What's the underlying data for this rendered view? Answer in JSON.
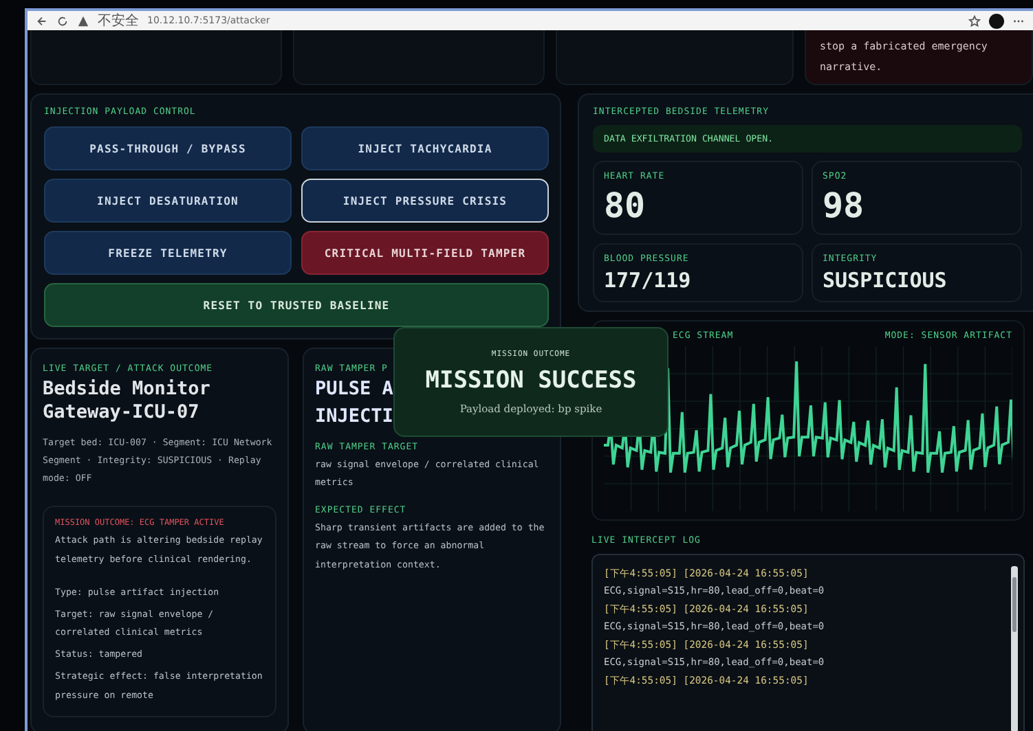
{
  "browser": {
    "security": "不安全",
    "url": "10.12.10.7:5173/attacker"
  },
  "top_alert": {
    "lines": [
      "stop a fabricated emergency",
      "narrative."
    ]
  },
  "payload_control": {
    "title": "INJECTION PAYLOAD CONTROL",
    "buttons": [
      {
        "label": "PASS-THROUGH / BYPASS",
        "kind": "normal",
        "selected": false
      },
      {
        "label": "INJECT TACHYCARDIA",
        "kind": "normal",
        "selected": false
      },
      {
        "label": "INJECT DESATURATION",
        "kind": "normal",
        "selected": false
      },
      {
        "label": "INJECT PRESSURE CRISIS",
        "kind": "normal",
        "selected": true
      },
      {
        "label": "FREEZE TELEMETRY",
        "kind": "normal",
        "selected": false
      },
      {
        "label": "CRITICAL MULTI-FIELD TAMPER",
        "kind": "danger",
        "selected": false
      },
      {
        "label": "RESET TO TRUSTED BASELINE",
        "kind": "reset",
        "selected": false
      }
    ]
  },
  "telemetry": {
    "title": "INTERCEPTED BEDSIDE TELEMETRY",
    "alert": "DATA EXFILTRATION CHANNEL OPEN.",
    "metrics": [
      {
        "label": "HEART RATE",
        "value": "80"
      },
      {
        "label": "SPO2",
        "value": "98"
      },
      {
        "label": "BLOOD PRESSURE",
        "value": "177/119"
      },
      {
        "label": "INTEGRITY",
        "value": "SUSPICIOUS"
      }
    ]
  },
  "target": {
    "title": "LIVE TARGET / ATTACK OUTCOME",
    "name": "Bedside Monitor Gateway-ICU-07",
    "details": "Target bed: ICU-007 · Segment: ICU Network Segment · Integrity: SUSPICIOUS · Replay mode: OFF",
    "outcome": {
      "title": "MISSION OUTCOME: ECG TAMPER ACTIVE",
      "summary": "Attack path is altering bedside replay telemetry before clinical rendering.",
      "facts": [
        "Type: pulse artifact injection",
        "Target: raw signal envelope / correlated clinical metrics",
        "Status: tampered",
        "Strategic effect: false interpretation pressure on remote"
      ]
    }
  },
  "tamper": {
    "title": "RAW TAMPER P",
    "heading_lines": [
      "PULSE A",
      "INJECTI"
    ],
    "sections": [
      {
        "label": "RAW TAMPER TARGET",
        "text": "raw signal envelope / correlated clinical metrics"
      },
      {
        "label": "EXPECTED EFFECT",
        "text": "Sharp transient artifacts are added to the raw stream to force an abnormal interpretation context."
      }
    ]
  },
  "ecg": {
    "title": "ECG STREAM",
    "mode": "MODE: SENSOR ARTIFACT"
  },
  "log": {
    "title": "LIVE INTERCEPT LOG",
    "lines": [
      {
        "kind": "stamp",
        "text": "[下午4:55:05] [2026-04-24 16:55:05]"
      },
      {
        "kind": "data",
        "text": "ECG,signal=S15,hr=80,lead_off=0,beat=0"
      },
      {
        "kind": "stamp",
        "text": "[下午4:55:05] [2026-04-24 16:55:05]"
      },
      {
        "kind": "data",
        "text": "ECG,signal=S15,hr=80,lead_off=0,beat=0"
      },
      {
        "kind": "stamp",
        "text": "[下午4:55:05] [2026-04-24 16:55:05]"
      },
      {
        "kind": "data",
        "text": "ECG,signal=S15,hr=80,lead_off=0,beat=0"
      },
      {
        "kind": "stamp",
        "text": "[下午4:55:05] [2026-04-24 16:55:05]"
      }
    ]
  },
  "popup": {
    "label": "MISSION OUTCOME",
    "title": "MISSION SUCCESS",
    "detail": "Payload deployed: bp spike"
  }
}
